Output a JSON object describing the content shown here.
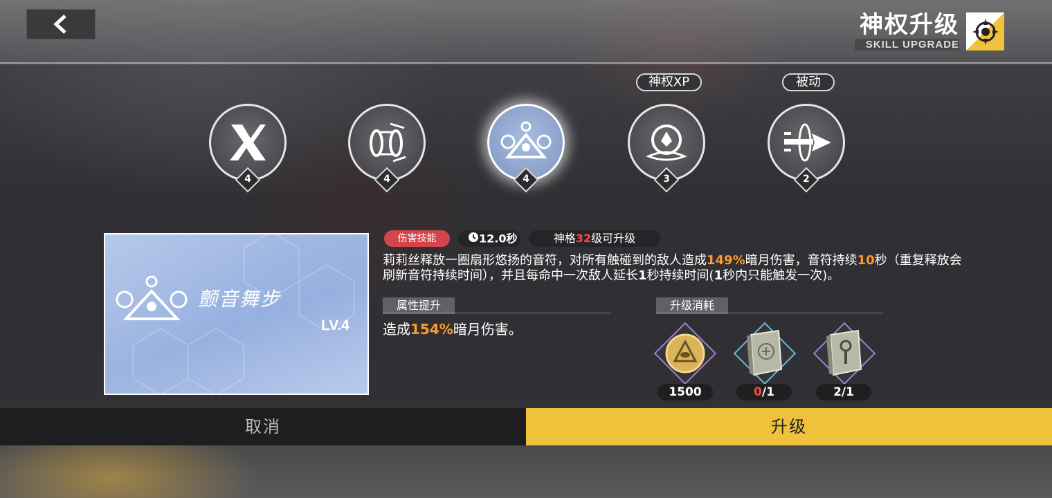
{
  "header": {
    "title_cn": "神权升级",
    "title_en": "SKILL UPGRADE"
  },
  "skills": [
    {
      "icon": "x-slash-skill-icon",
      "level": "4",
      "active": false
    },
    {
      "icon": "sound-wave-skill-icon",
      "level": "4",
      "active": false
    },
    {
      "icon": "music-note-triangle-skill-icon",
      "level": "4",
      "active": true
    },
    {
      "icon": "phoenix-emblem-skill-icon",
      "level": "3",
      "active": false,
      "tag": "神权XP"
    },
    {
      "icon": "arrow-burst-skill-icon",
      "level": "2",
      "active": false,
      "tag": "被动"
    }
  ],
  "card": {
    "name": "颤音舞步",
    "level": "LV.4"
  },
  "badges": {
    "type": "伤害技能",
    "cooldown": "12.0秒",
    "req_prefix": "神格",
    "req_level": "32",
    "req_suffix": "级可升级"
  },
  "description": {
    "p1": "莉莉丝释放一圈扇形悠扬的音符，对所有触碰到的敌人造成",
    "v1": "149%",
    "p2": "暗月伤害，音符持续",
    "v2": "10",
    "p3": "秒（重复释放会刷新音符持续时间），并且每命中一次敌人延长",
    "v3": "1",
    "p4": "秒持续时间(",
    "v4": "1",
    "p5": "秒内只能触发一次)。"
  },
  "attribute": {
    "section_title": "属性提升",
    "prefix": "造成",
    "value": "154%",
    "suffix": "暗月伤害。"
  },
  "cost": {
    "section_title": "升级消耗",
    "items": [
      {
        "icon": "gold-coin-eye-icon",
        "count": "1500",
        "frame_color": "#9b7fd1"
      },
      {
        "icon": "skill-book-icon",
        "have": "0",
        "need": "/1",
        "frame_color": "#6fb6d9"
      },
      {
        "icon": "skill-book-key-icon",
        "count": "2/1",
        "frame_color": "#9b7fd1"
      }
    ]
  },
  "buttons": {
    "cancel": "取消",
    "upgrade": "升级"
  },
  "colors": {
    "accent": "#f0c23c",
    "highlight": "#ff9a2c",
    "damage_badge": "#d3454a"
  }
}
